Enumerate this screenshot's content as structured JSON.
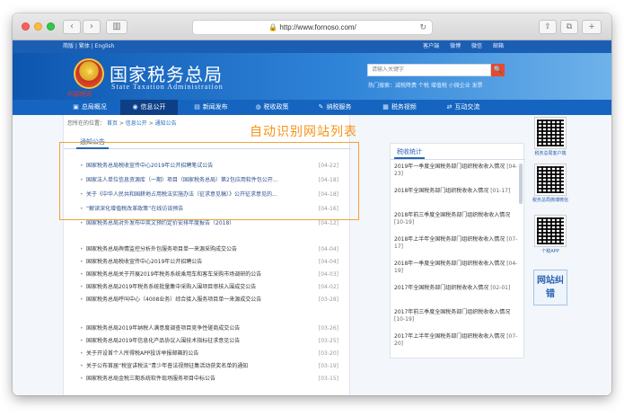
{
  "browser": {
    "url": "http://www.fornoso.com/"
  },
  "site": {
    "top_left": "简版 | 繁体 | English",
    "top_right": [
      "客户端",
      "微博",
      "微信",
      "邮箱"
    ],
    "title_cn": "国家税务总局",
    "title_en": "State Taxation Administration",
    "signature": "中国税务",
    "search_placeholder": "请输入关键字",
    "search_button": "🔍",
    "hot_words": "热门搜索：减税降费 个税 增值税 小微企业 发票"
  },
  "nav": {
    "items": [
      {
        "label": "总局概况",
        "icon": "building-icon"
      },
      {
        "label": "信息公开",
        "icon": "chat-icon"
      },
      {
        "label": "新闻发布",
        "icon": "news-icon"
      },
      {
        "label": "税收政策",
        "icon": "policy-icon"
      },
      {
        "label": "纳税服务",
        "icon": "service-icon"
      },
      {
        "label": "税务视频",
        "icon": "video-icon"
      },
      {
        "label": "互动交流",
        "icon": "exchange-icon"
      }
    ]
  },
  "breadcrumb": {
    "prefix": "您所在的位置：",
    "items": [
      "首页",
      "信息公开",
      "通知公告"
    ]
  },
  "main": {
    "section_title": "通知公告",
    "overlay_label": "自动识别网站列表",
    "highlighted_rows": [
      {
        "text": "国家税务总局税收宣传中心2019年公开招聘笔试公告",
        "date": "[04-22]"
      },
      {
        "text": "国家法人单位信息资源库（一期）项目（国家税务总局）第2包应用软件包公开...",
        "date": "[04-18]"
      },
      {
        "text": "关于《中华人民共和国耕地占用税法实施办法（征求意见稿）》公开征求意见的...",
        "date": "[04-18]"
      },
      {
        "text": "“解读深化增值税改革政策”在线访谈预告",
        "date": "[04-16]"
      },
      {
        "text": "国家税务总局对外发布中英文预约定价安排年度报告（2018）",
        "date": "[04-12]"
      }
    ],
    "rows_1": [
      {
        "text": "国家税务总局舆情监控分析外包服务项目单一来源采购成交公告",
        "date": "[04-04]"
      },
      {
        "text": "国家税务总局税收宣传中心2019年公开招聘公告",
        "date": "[04-04]"
      },
      {
        "text": "国家税务总局关于开展2019年税务系统乘用车和客车采购市场调研的公告",
        "date": "[04-03]"
      },
      {
        "text": "国家税务总局2019年税务系统批量集中采购入围项目审核入围成交公告",
        "date": "[04-02]"
      },
      {
        "text": "国家税务总局呼叫中心（4008业务）综合接入服务项目单一来源成交公告",
        "date": "[03-28]"
      }
    ],
    "rows_2": [
      {
        "text": "国家税务总局2019年纳税人满意度调查项目竞争性磋商成交公告",
        "date": "[03-26]"
      },
      {
        "text": "国家税务总局2019年信息化产品协议入围技术指标征求意见公告",
        "date": "[03-25]"
      },
      {
        "text": "关于开设首个人所得税APP投诉举报邮箱的公告",
        "date": "[03-20]"
      },
      {
        "text": "关于公布首届“税宣讲税法”青少年普法视频征集活动获奖名单的通知",
        "date": "[03-19]"
      },
      {
        "text": "国家税务总局金税三期系统软件现场服务项目中标公告",
        "date": "[03-15]"
      }
    ]
  },
  "stats": {
    "title": "税收统计",
    "items": [
      {
        "text": "2019年一季度全国税务部门组织税收收入情况",
        "date": "[04-23]"
      },
      {
        "text": "2018年全国税务部门组织税收收入情况",
        "date": "[01-17]"
      },
      {
        "text": "2018年前三季度全国税务部门组织税收收入情况",
        "date": "[10-19]"
      },
      {
        "text": "2018年上半年全国税务部门组织税收收入情况",
        "date": "[07-17]"
      },
      {
        "text": "2018年一季度全国税务部门组织税收收入情况",
        "date": "[04-19]"
      },
      {
        "text": "2017年全国税务部门组织税收收入情况",
        "date": "[02-01]"
      },
      {
        "text": "2017年前三季度全国税务部门组织税收收入情况",
        "date": "[10-19]"
      },
      {
        "text": "2017年上半年全国税务部门组织税收收入情况",
        "date": "[07-20]"
      }
    ]
  },
  "sidebar": {
    "qr1_label": "税务总局客户端",
    "qr2_label": "税务总局微博微信",
    "qr3_label": "个税APP",
    "button_label": "网站纠错"
  }
}
